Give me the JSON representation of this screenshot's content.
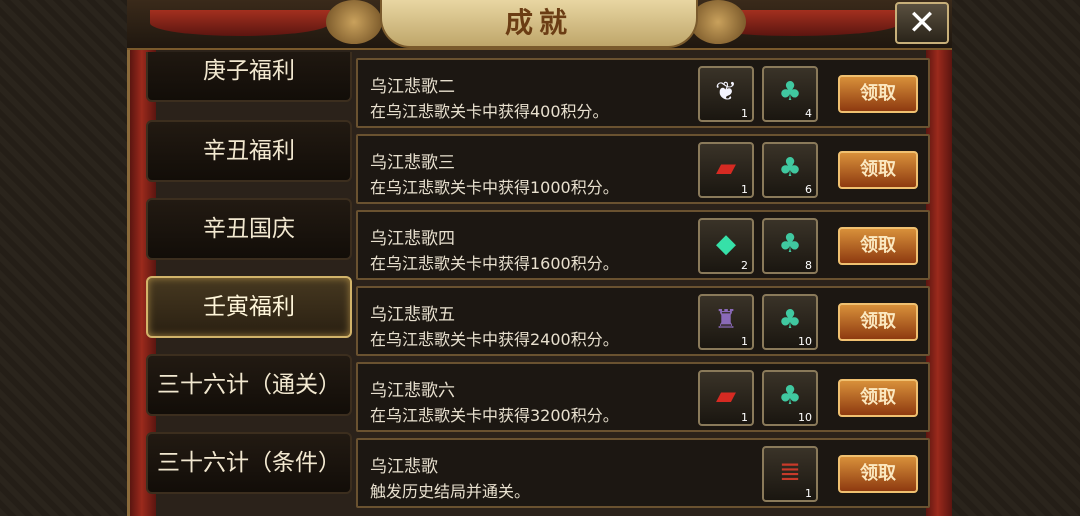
{
  "title": "成就",
  "close_label": "✕",
  "tabs": [
    {
      "label": "庚子福利",
      "active": false
    },
    {
      "label": "辛丑福利",
      "active": false
    },
    {
      "label": "辛丑国庆",
      "active": false
    },
    {
      "label": "壬寅福利",
      "active": true
    },
    {
      "label": "三十六计（通关）",
      "active": false
    },
    {
      "label": "三十六计（条件）",
      "active": false
    }
  ],
  "claim_label": "领取",
  "achievements": [
    {
      "title": "乌江悲歌二",
      "desc": "在乌江悲歌关卡中获得400积分。",
      "rewards": [
        {
          "icon": "wing-icon",
          "count": "1"
        },
        {
          "icon": "jade-pendant-icon",
          "count": "4"
        }
      ]
    },
    {
      "title": "乌江悲歌三",
      "desc": "在乌江悲歌关卡中获得1000积分。",
      "rewards": [
        {
          "icon": "red-book-icon",
          "count": "1"
        },
        {
          "icon": "jade-pendant-icon",
          "count": "6"
        }
      ]
    },
    {
      "title": "乌江悲歌四",
      "desc": "在乌江悲歌关卡中获得1600积分。",
      "rewards": [
        {
          "icon": "green-gem-icon",
          "count": "2"
        },
        {
          "icon": "jade-pendant-icon",
          "count": "8"
        }
      ]
    },
    {
      "title": "乌江悲歌五",
      "desc": "在乌江悲歌关卡中获得2400积分。",
      "rewards": [
        {
          "icon": "armor-icon",
          "count": "1"
        },
        {
          "icon": "jade-pendant-icon",
          "count": "10"
        }
      ]
    },
    {
      "title": "乌江悲歌六",
      "desc": "在乌江悲歌关卡中获得3200积分。",
      "rewards": [
        {
          "icon": "red-book-icon",
          "count": "1"
        },
        {
          "icon": "jade-pendant-icon",
          "count": "10"
        }
      ]
    },
    {
      "title": "乌江悲歌",
      "desc": "触发历史结局并通关。",
      "rewards": [
        {
          "icon": "book-stack-icon",
          "count": "1"
        }
      ]
    }
  ],
  "colors": {
    "accent": "#d2b46a",
    "claim_button": "#c8702a",
    "panel": "#1c1712"
  }
}
